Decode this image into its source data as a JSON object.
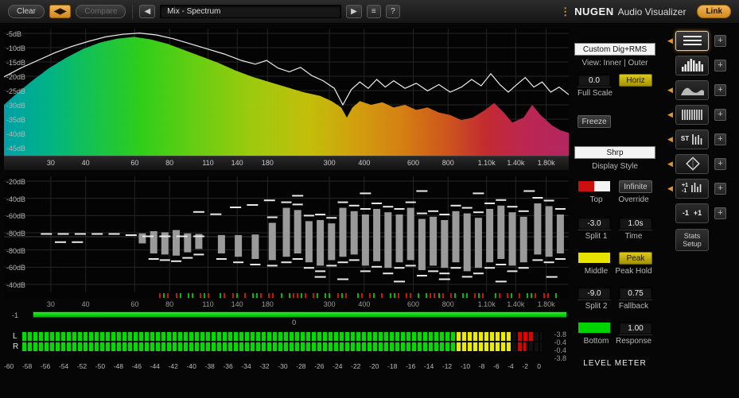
{
  "icons": {
    "swap": "◀▶",
    "prev": "◀",
    "play": "▶",
    "menu": "≡",
    "dots": "⋮",
    "slot_arrow": "◀",
    "plus": "+"
  },
  "toolbar": {
    "clear": "Clear",
    "compare": "Compare",
    "preset_name": "Mix - Spectrum",
    "help": "?",
    "brand_name": "NUGEN",
    "brand_product": "Audio Visualizer",
    "link": "Link"
  },
  "freq_axis": [
    {
      "label": "30",
      "f": 30
    },
    {
      "label": "40",
      "f": 40
    },
    {
      "label": "60",
      "f": 60
    },
    {
      "label": "80",
      "f": 80
    },
    {
      "label": "110",
      "f": 110
    },
    {
      "label": "140",
      "f": 140
    },
    {
      "label": "180",
      "f": 180
    },
    {
      "label": "300",
      "f": 300
    },
    {
      "label": "400",
      "f": 400
    },
    {
      "label": "600",
      "f": 600
    },
    {
      "label": "800",
      "f": 800
    },
    {
      "label": "1.10k",
      "f": 1100
    },
    {
      "label": "1.40k",
      "f": 1400
    },
    {
      "label": "1.80k",
      "f": 1800
    }
  ],
  "spectrum_chart": {
    "type": "area",
    "db_labels": [
      "-5dB",
      "-10dB",
      "-15dB",
      "-20dB",
      "-25dB",
      "-30dB",
      "-35dB",
      "-40dB",
      "-45dB"
    ],
    "gradient": [
      [
        0,
        "#00a8b0"
      ],
      [
        0.08,
        "#00bc8c"
      ],
      [
        0.16,
        "#18cc50"
      ],
      [
        0.24,
        "#30d81c"
      ],
      [
        0.34,
        "#6cd812"
      ],
      [
        0.44,
        "#a6d40e"
      ],
      [
        0.54,
        "#ccc80a"
      ],
      [
        0.62,
        "#dca80e"
      ],
      [
        0.7,
        "#e08814"
      ],
      [
        0.78,
        "#d85c1c"
      ],
      [
        0.855,
        "#cc2c34"
      ],
      [
        0.93,
        "#c42858"
      ],
      [
        1,
        "#bc2866"
      ]
    ],
    "fill_points": [
      [
        0,
        0.6
      ],
      [
        0.02,
        0.52
      ],
      [
        0.05,
        0.41
      ],
      [
        0.08,
        0.31
      ],
      [
        0.11,
        0.23
      ],
      [
        0.14,
        0.16
      ],
      [
        0.17,
        0.11
      ],
      [
        0.2,
        0.08
      ],
      [
        0.23,
        0.065
      ],
      [
        0.26,
        0.085
      ],
      [
        0.29,
        0.12
      ],
      [
        0.32,
        0.17
      ],
      [
        0.35,
        0.22
      ],
      [
        0.38,
        0.27
      ],
      [
        0.41,
        0.33
      ],
      [
        0.44,
        0.38
      ],
      [
        0.47,
        0.42
      ],
      [
        0.5,
        0.46
      ],
      [
        0.53,
        0.5
      ],
      [
        0.56,
        0.53
      ],
      [
        0.58,
        0.57
      ],
      [
        0.597,
        0.62
      ],
      [
        0.607,
        0.7
      ],
      [
        0.617,
        0.62
      ],
      [
        0.63,
        0.57
      ],
      [
        0.65,
        0.6
      ],
      [
        0.67,
        0.58
      ],
      [
        0.69,
        0.62
      ],
      [
        0.71,
        0.6
      ],
      [
        0.73,
        0.64
      ],
      [
        0.75,
        0.62
      ],
      [
        0.77,
        0.66
      ],
      [
        0.79,
        0.68
      ],
      [
        0.81,
        0.72
      ],
      [
        0.83,
        0.7
      ],
      [
        0.85,
        0.645
      ],
      [
        0.868,
        0.585
      ],
      [
        0.885,
        0.66
      ],
      [
        0.9,
        0.74
      ],
      [
        0.92,
        0.7
      ],
      [
        0.935,
        0.6
      ],
      [
        0.95,
        0.68
      ],
      [
        0.97,
        0.76
      ],
      [
        0.985,
        0.8
      ],
      [
        1,
        0.82
      ]
    ],
    "line_points": [
      [
        0,
        0.38
      ],
      [
        0.03,
        0.31
      ],
      [
        0.06,
        0.25
      ],
      [
        0.09,
        0.19
      ],
      [
        0.12,
        0.14
      ],
      [
        0.15,
        0.1
      ],
      [
        0.18,
        0.065
      ],
      [
        0.21,
        0.045
      ],
      [
        0.24,
        0.035
      ],
      [
        0.27,
        0.05
      ],
      [
        0.3,
        0.08
      ],
      [
        0.33,
        0.12
      ],
      [
        0.36,
        0.16
      ],
      [
        0.39,
        0.2
      ],
      [
        0.42,
        0.25
      ],
      [
        0.445,
        0.28
      ],
      [
        0.465,
        0.25
      ],
      [
        0.485,
        0.31
      ],
      [
        0.505,
        0.34
      ],
      [
        0.525,
        0.305
      ],
      [
        0.545,
        0.37
      ],
      [
        0.565,
        0.41
      ],
      [
        0.585,
        0.47
      ],
      [
        0.6,
        0.6
      ],
      [
        0.615,
        0.48
      ],
      [
        0.63,
        0.42
      ],
      [
        0.645,
        0.47
      ],
      [
        0.66,
        0.4
      ],
      [
        0.675,
        0.46
      ],
      [
        0.69,
        0.41
      ],
      [
        0.71,
        0.47
      ],
      [
        0.73,
        0.43
      ],
      [
        0.75,
        0.49
      ],
      [
        0.77,
        0.44
      ],
      [
        0.79,
        0.5
      ],
      [
        0.81,
        0.46
      ],
      [
        0.828,
        0.4
      ],
      [
        0.845,
        0.45
      ],
      [
        0.862,
        0.355
      ],
      [
        0.878,
        0.44
      ],
      [
        0.893,
        0.5
      ],
      [
        0.908,
        0.44
      ],
      [
        0.923,
        0.385
      ],
      [
        0.938,
        0.46
      ],
      [
        0.953,
        0.42
      ],
      [
        0.968,
        0.5
      ],
      [
        0.983,
        0.46
      ],
      [
        1,
        0.52
      ]
    ]
  },
  "histogram_chart": {
    "type": "bar",
    "db_labels": [
      "-20dB",
      "-40dB",
      "-60dB",
      "-80dB",
      "-80dB",
      "-60dB",
      "-40dB"
    ],
    "bars": [
      [
        0.245,
        0.06,
        0.12
      ],
      [
        0.265,
        0.1,
        0.3
      ],
      [
        0.285,
        0.08,
        0.32
      ],
      [
        0.305,
        0.12,
        0.34
      ],
      [
        0.325,
        0.06,
        0.28
      ],
      [
        0.345,
        0.05,
        0.22
      ],
      [
        0.385,
        0.03,
        0.3
      ],
      [
        0.415,
        0.03,
        0.36
      ],
      [
        0.445,
        0.04,
        0.4
      ],
      [
        0.475,
        0.25,
        0.42
      ],
      [
        0.5,
        0.52,
        0.36
      ],
      [
        0.52,
        0.48,
        0.3
      ],
      [
        0.54,
        0.28,
        0.46
      ],
      [
        0.56,
        0.3,
        0.52
      ],
      [
        0.58,
        0.24,
        0.42
      ],
      [
        0.6,
        0.52,
        0.36
      ],
      [
        0.62,
        0.46,
        0.32
      ],
      [
        0.64,
        0.4,
        0.52
      ],
      [
        0.66,
        0.5,
        0.44
      ],
      [
        0.68,
        0.44,
        0.56
      ],
      [
        0.7,
        0.4,
        0.46
      ],
      [
        0.72,
        0.52,
        0.42
      ],
      [
        0.74,
        0.32,
        0.6
      ],
      [
        0.76,
        0.36,
        0.52
      ],
      [
        0.78,
        0.3,
        0.56
      ],
      [
        0.8,
        0.46,
        0.46
      ],
      [
        0.82,
        0.42,
        0.62
      ],
      [
        0.84,
        0.34,
        0.56
      ],
      [
        0.86,
        0.5,
        0.46
      ],
      [
        0.88,
        0.56,
        0.4
      ],
      [
        0.9,
        0.44,
        0.52
      ],
      [
        0.92,
        0.36,
        0.46
      ],
      [
        0.945,
        0.6,
        0.32
      ],
      [
        0.965,
        0.55,
        0.36
      ],
      [
        0.985,
        0.4,
        0.3
      ]
    ],
    "dashes": [
      [
        0.075,
        0.49
      ],
      [
        0.105,
        0.49
      ],
      [
        0.135,
        0.49
      ],
      [
        0.165,
        0.49
      ],
      [
        0.195,
        0.49
      ],
      [
        0.225,
        0.5
      ],
      [
        0.255,
        0.51
      ],
      [
        0.285,
        0.51
      ],
      [
        0.315,
        0.51
      ],
      [
        0.345,
        0.51
      ],
      [
        0.1,
        0.56
      ],
      [
        0.13,
        0.56
      ],
      [
        0.345,
        0.3
      ],
      [
        0.375,
        0.32
      ],
      [
        0.41,
        0.26
      ],
      [
        0.44,
        0.24
      ],
      [
        0.47,
        0.2
      ],
      [
        0.52,
        0.16
      ],
      [
        0.56,
        0.86
      ],
      [
        0.6,
        0.88
      ],
      [
        0.64,
        0.14
      ],
      [
        0.7,
        0.9
      ],
      [
        0.74,
        0.12
      ],
      [
        0.78,
        0.88
      ],
      [
        0.84,
        0.14
      ],
      [
        0.88,
        0.9
      ],
      [
        0.93,
        0.12
      ],
      [
        0.97,
        0.86
      ]
    ],
    "tick_pattern": "rgr-rg-gg-rgr--gr-rg-r-ggr-rr-g-gr"
  },
  "correlation": {
    "min_label": "-1",
    "zero_label": "0"
  },
  "level_meter": {
    "channel_labels": [
      "L",
      "R"
    ],
    "readouts": [
      "-3.8",
      "-0.4",
      "-0.4",
      "-3.8"
    ],
    "green_pct": 83.5,
    "yellow_pct": 10.5,
    "peaks": [
      [
        95.3,
        3.4
      ],
      [
        95.3,
        1.7
      ]
    ],
    "scale_labels": [
      "-60",
      "-58",
      "-56",
      "-54",
      "-52",
      "-50",
      "-48",
      "-46",
      "-44",
      "-42",
      "-40",
      "-38",
      "-36",
      "-34",
      "-32",
      "-30",
      "-28",
      "-26",
      "-24",
      "-22",
      "-20",
      "-18",
      "-16",
      "-14",
      "-12",
      "-10",
      "-8",
      "-6",
      "-4",
      "-2",
      "0"
    ]
  },
  "controls": {
    "preset": "Custom Dig+RMS",
    "view": "View: Inner | Outer",
    "full_scale_value": "0.0",
    "horiz": "Horiz",
    "full_scale_label": "Full Scale",
    "freeze": "Freeze",
    "display_style_value": "Shrp",
    "display_style_label": "Display Style",
    "top_label": "Top",
    "override_value": "Infinite",
    "override_label": "Override",
    "split1_value": "-3.0",
    "split1_label": "Split 1",
    "time_value": "1.0s",
    "time_label": "Time",
    "middle_label": "Middle",
    "peak_hold_value": "Peak",
    "peak_hold_label": "Peak Hold",
    "split2_value": "-9.0",
    "split2_label": "Split 2",
    "fallback_value": "0.75",
    "fallback_label": "Fallback",
    "bottom_label": "Bottom",
    "response_value": "1.00",
    "response_label": "Response",
    "section_title": "LEVEL METER",
    "swatch_top": [
      "#cc1010",
      "#f4f4f4"
    ],
    "swatch_middle": "#e8e400",
    "swatch_bottom": "#00d400"
  },
  "sidebar": {
    "st_label": "ST",
    "mini_plus": "+1",
    "mini_minus": "-1",
    "range_minus": "-1",
    "range_plus": "+1",
    "stats_line1": "Stats",
    "stats_line2": "Setup"
  }
}
